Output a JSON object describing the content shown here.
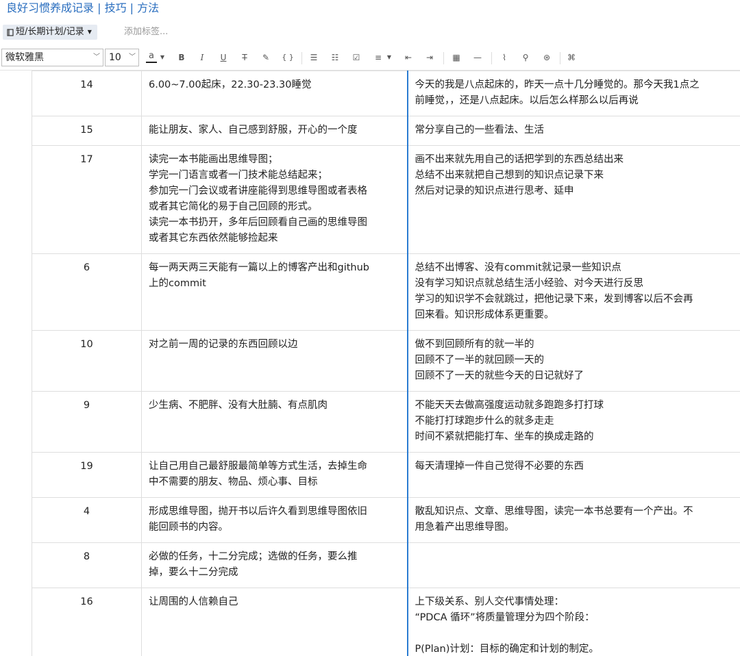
{
  "note": {
    "title": "良好习惯养成记录 | 技巧 | 方法"
  },
  "tagbar": {
    "notebook": "短/长期计划/记录",
    "tag_placeholder": "添加标签..."
  },
  "toolbar": {
    "font_family": "微软雅黑",
    "font_size": "10",
    "icons": [
      "text-color",
      "bold",
      "italic",
      "underline",
      "strikethrough",
      "highlight",
      "code",
      "bullet-list",
      "numbered-list",
      "checkbox",
      "align",
      "outdent",
      "indent",
      "table",
      "horizontal-rule",
      "attachment",
      "link",
      "globe",
      "command"
    ]
  },
  "table": {
    "rows": [
      {
        "num": "14",
        "goal": [
          "6.00~7.00起床，22.30-23.30睡觉"
        ],
        "method": [
          "今天的我是八点起床的，昨天一点十几分睡觉的。那今天我1点之",
          "前睡觉，，还是八点起床。以后怎么样那么以后再说"
        ]
      },
      {
        "num": "15",
        "goal": [
          "能让朋友、家人、自己感到舒服，开心的一个度"
        ],
        "method": [
          "常分享自己的一些看法、生活"
        ]
      },
      {
        "num": "17",
        "goal": [
          "读完一本书能画出思维导图；",
          "学完一门语言或者一门技术能总结起来；",
          "参加完一门会议或者讲座能得到思维导图或者表格",
          "或者其它简化的易于自己回顾的形式。",
          "读完一本书扔开，多年后回顾看自己画的思维导图",
          "或者其它东西依然能够捡起来"
        ],
        "method": [
          "画不出来就先用自己的话把学到的东西总结出来",
          "总结不出来就把自己想到的知识点记录下来",
          "然后对记录的知识点进行思考、延申"
        ]
      },
      {
        "num": "6",
        "goal": [
          "每一两天两三天能有一篇以上的博客产出和github",
          "上的commit"
        ],
        "method": [
          "总结不出博客、没有commit就记录一些知识点",
          "没有学习知识点就总结生活小经验、对今天进行反思",
          "学习的知识学不会就跳过，把他记录下来，发到博客以后不会再",
          "回来看。知识形成体系更重要。"
        ]
      },
      {
        "num": "10",
        "goal": [
          "对之前一周的记录的东西回顾以边"
        ],
        "method": [
          "做不到回顾所有的就一半的",
          "回顾不了一半的就回顾一天的",
          "回顾不了一天的就些今天的日记就好了"
        ]
      },
      {
        "num": "9",
        "goal": [
          "少生病、不肥胖、没有大肚腩、有点肌肉"
        ],
        "method": [
          "不能天天去做高强度运动就多跑跑多打打球",
          "不能打打球跑步什么的就多走走",
          "时间不紧就把能打车、坐车的换成走路的"
        ]
      },
      {
        "num": "19",
        "goal": [
          "让自己用自己最舒服最简单等方式生活，去掉生命",
          "中不需要的朋友、物品、烦心事、目标"
        ],
        "method": [
          "每天清理掉一件自己觉得不必要的东西"
        ]
      },
      {
        "num": "4",
        "goal": [
          "形成思维导图，抛开书以后许久看到思维导图依旧",
          "能回顾书的内容。"
        ],
        "method": [
          "散乱知识点、文章、思维导图，读完一本书总要有一个产出。不",
          "用急着产出思维导图。"
        ]
      },
      {
        "num": "8",
        "goal": [
          "必做的任务，十二分完成；选做的任务，要么推",
          "掉，要么十二分完成"
        ],
        "method": []
      },
      {
        "num": "16",
        "goal": [
          "让周围的人信赖自己"
        ],
        "method": [
          "上下级关系、别人交代事情处理：",
          "“PDCA 循环”将质量管理分为四个阶段：",
          "",
          "P(Plan)计划：目标的确定和计划的制定。"
        ]
      }
    ]
  }
}
